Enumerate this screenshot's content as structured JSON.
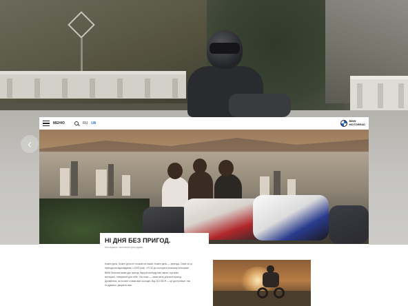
{
  "header": {
    "menu_label": "МЕНЮ",
    "languages": [
      {
        "code": "RU",
        "active": false
      },
      {
        "code": "UA",
        "active": true
      }
    ],
    "brand_line1": "BMW",
    "brand_line2": "MOTORRAD"
  },
  "article": {
    "headline": "НІ ДНЯ БЕЗ ПРИГОД.",
    "subhead": "Мотоцикли, натхненні пригодами.",
    "paragraphs": [
      "Кожен день. Кожен день не схожий на інший. Кожен день — пригода. Саме за ці",
      "пригоди ми відповідаємо з 1923 року: з R 32 до сьогодні в кожному мотоциклі",
      "BMW Motorrad живе дух пригод. Відчуй свободу вже зараз і зустрінь",
      "мотоцикл, створений для тебе. Усе інше — лише мить для всіх пригод.",
      "Дізнайтеся, як почати з нами вже сьогодні. Від 210 000 ₴ — це доступніше, ніж",
      "ти думаєш, дякуючи нам."
    ]
  },
  "icons": {
    "menu": "hamburger-icon",
    "search": "search-icon",
    "brand": "bmw-roundel-logo",
    "carousel_prev": "chevron-left-icon"
  },
  "colors": {
    "accent": "#1c69d4",
    "text": "#1a1a1a"
  }
}
